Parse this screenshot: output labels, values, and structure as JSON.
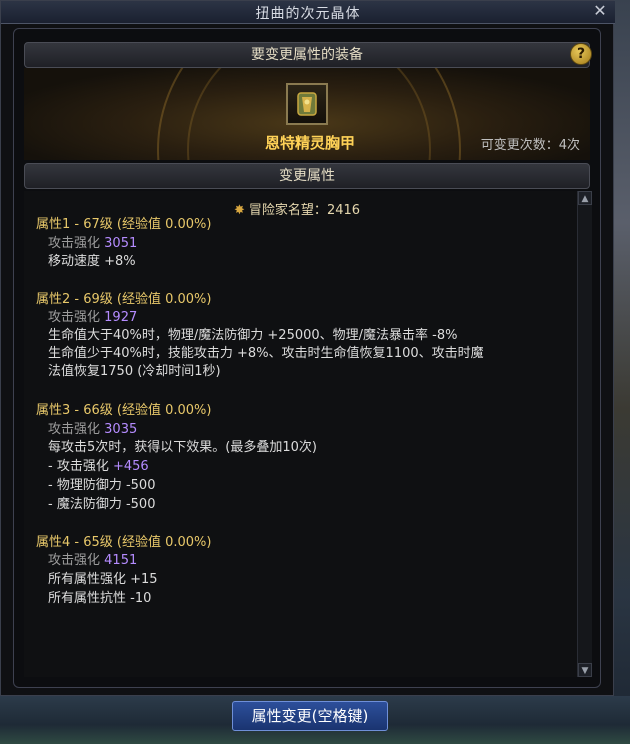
{
  "window": {
    "title": "扭曲的次元晶体"
  },
  "header": {
    "equipment_title": "要变更属性的装备",
    "help": "?"
  },
  "equipment": {
    "icon_name": "chest-armor-icon",
    "name": "恩特精灵胸甲",
    "change_count": "可变更次数：4次"
  },
  "section": {
    "change_title": "变更属性"
  },
  "reputation": {
    "icon": "crest-icon",
    "label": "冒险家名望",
    "value": "2416"
  },
  "attributes": [
    {
      "head": "属性1 - 67级 (经验值 0.00%)",
      "stat_label": "攻击强化",
      "stat_value": "3051",
      "lines": [
        "移动速度 +8%"
      ]
    },
    {
      "head": "属性2 - 69级 (经验值 0.00%)",
      "stat_label": "攻击强化",
      "stat_value": "1927",
      "lines": [
        "生命值大于40%时，物理/魔法防御力 +25000、物理/魔法暴击率 -8%",
        "生命值少于40%时，技能攻击力 +8%、攻击时生命值恢复1100、攻击时魔",
        "法值恢复1750 (冷却时间1秒)"
      ]
    },
    {
      "head": "属性3 - 66级 (经验值 0.00%)",
      "stat_label": "攻击强化",
      "stat_value": "3035",
      "lines": [
        "每攻击5次时，获得以下效果。(最多叠加10次)"
      ],
      "extra": [
        {
          "prefix": " - 攻击强化",
          "value": "+456"
        },
        {
          "prefix": " - 物理防御力 -500"
        },
        {
          "prefix": " - 魔法防御力 -500"
        }
      ]
    },
    {
      "head": "属性4 - 65级 (经验值 0.00%)",
      "stat_label": "攻击强化",
      "stat_value": "4151",
      "lines": [
        "所有属性强化 +15",
        "所有属性抗性 -10"
      ]
    }
  ],
  "actions": {
    "change_button": "属性变更(空格键)"
  },
  "colors": {
    "accent_gold": "#e8c86a",
    "value_purple": "#b58cff",
    "button_blue": "#2d4f9b"
  }
}
